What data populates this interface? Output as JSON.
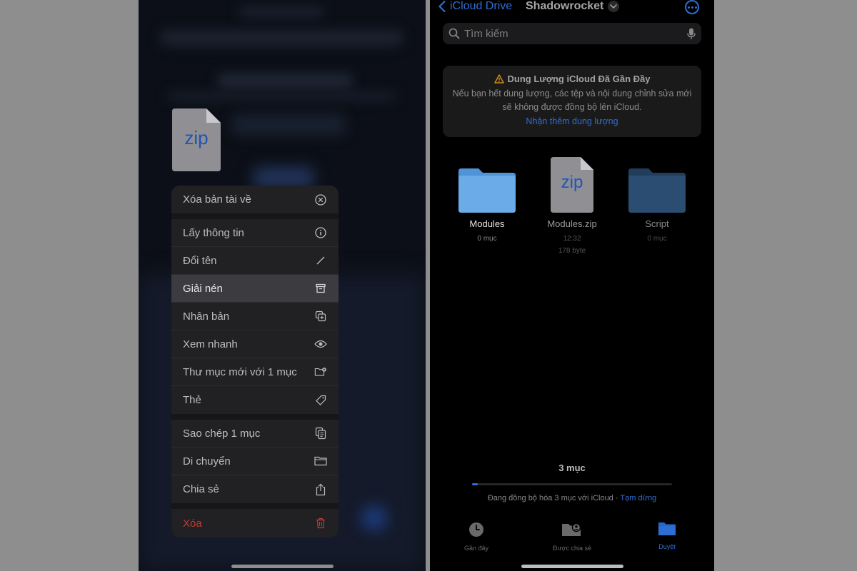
{
  "left": {
    "preview": {
      "file_badge": "zip"
    },
    "menu": {
      "items": [
        {
          "label": "Xóa bản tài về",
          "icon": "remove-download-icon"
        },
        {
          "label": "Lấy thông tin",
          "icon": "info-icon"
        },
        {
          "label": "Đổi tên",
          "icon": "pencil-icon"
        },
        {
          "label": "Giải nén",
          "icon": "archive-box-icon",
          "highlighted": true
        },
        {
          "label": "Nhân bản",
          "icon": "duplicate-icon"
        },
        {
          "label": "Xem nhanh",
          "icon": "eye-icon"
        },
        {
          "label": "Thư mục mới với 1 mục",
          "icon": "folder-badge-plus-icon"
        },
        {
          "label": "Thẻ",
          "icon": "tag-icon"
        },
        {
          "label": "Sao chép 1 mục",
          "icon": "copy-icon"
        },
        {
          "label": "Di chuyển",
          "icon": "folder-icon"
        },
        {
          "label": "Chia sẻ",
          "icon": "share-icon"
        },
        {
          "label": "Xóa",
          "icon": "trash-icon",
          "destructive": true
        }
      ]
    }
  },
  "right": {
    "nav": {
      "back_label": "iCloud Drive",
      "title": "Shadowrocket"
    },
    "search": {
      "placeholder": "Tìm kiếm"
    },
    "banner": {
      "title": "Dung Lượng iCloud Đã Gần Đầy",
      "body": "Nếu bạn hết dung lượng, các tệp và nội dung chỉnh sửa mới sẽ không được đồng bộ lên iCloud.",
      "link": "Nhận thêm dung lượng"
    },
    "files": [
      {
        "name": "Modules",
        "meta1": "0 mục",
        "meta2": ""
      },
      {
        "name": "Modules.zip",
        "meta1": "12:32",
        "meta2": "178 byte",
        "badge": "zip"
      },
      {
        "name": "Script",
        "meta1": "0 mục",
        "meta2": ""
      }
    ],
    "count": "3 mục",
    "sync": {
      "text": "Đang đồng bộ hóa 3 mục với iCloud",
      "separator": "·",
      "pause": "Tạm dừng",
      "progress": 0.03
    },
    "tabs": [
      {
        "label": "Gần đây",
        "icon": "clock-icon"
      },
      {
        "label": "Được chia sẻ",
        "icon": "shared-folder-icon"
      },
      {
        "label": "Duyệt",
        "icon": "folder-icon",
        "active": true
      }
    ],
    "colors": {
      "accent": "#2e6ed3",
      "destructive": "#c43a33",
      "folder_light": "#6aabe8",
      "folder_dark": "#2b4d72"
    }
  }
}
